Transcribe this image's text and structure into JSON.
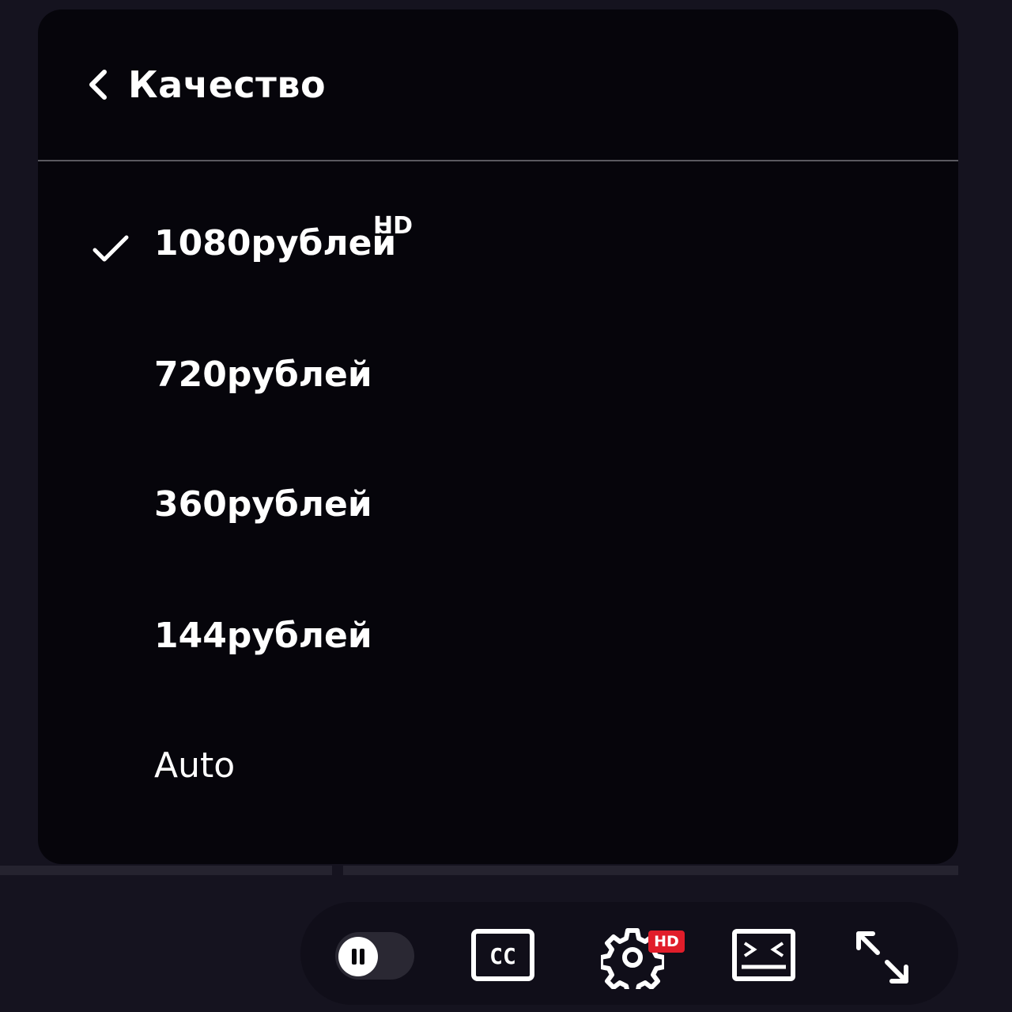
{
  "menu": {
    "title": "Качество",
    "options": [
      {
        "label": "1080рублей",
        "badge": "HD",
        "selected": true
      },
      {
        "label": "720рублей",
        "selected": false
      },
      {
        "label": "360рублей",
        "selected": false
      },
      {
        "label": "144рублей",
        "selected": false
      },
      {
        "label": "Auto",
        "selected": false
      }
    ]
  },
  "controls": {
    "autoplay_toggle": {
      "state": "on",
      "icon": "pause-icon"
    },
    "captions_icon": "cc-icon",
    "captions_text": "CC",
    "settings_icon": "gear-icon",
    "settings_badge": "HD",
    "theater_icon": "theater-mode-icon",
    "fullscreen_icon": "fullscreen-icon"
  },
  "colors": {
    "menu_bg": "#06050b",
    "page_bg": "#15131f",
    "text": "#ffffff",
    "badge_red": "#e11d2a"
  }
}
